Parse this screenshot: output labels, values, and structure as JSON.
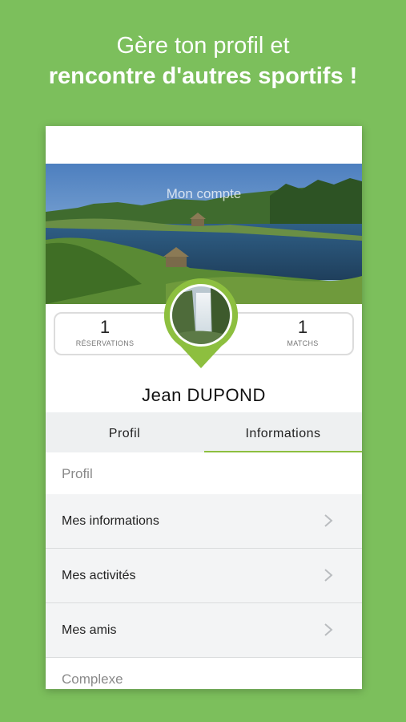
{
  "headline": {
    "line1": "Gère ton profil et",
    "line2": "rencontre d'autres sportifs !"
  },
  "screen": {
    "header_title": "Mon compte",
    "stats": [
      {
        "value": "1",
        "label": "RÉSERVATIONS"
      },
      {
        "value": "1",
        "label": "MATCHS"
      }
    ],
    "user_name": "Jean  DUPOND",
    "tabs": [
      {
        "label": "Profil",
        "active": false
      },
      {
        "label": "Informations",
        "active": true
      }
    ],
    "sections": [
      {
        "title": "Profil",
        "items": [
          {
            "label": "Mes informations",
            "icon": "chevron-right-icon"
          },
          {
            "label": "Mes activités",
            "icon": "chevron-right-icon"
          },
          {
            "label": "Mes amis",
            "icon": "chevron-right-icon"
          }
        ]
      },
      {
        "title": "Complexe",
        "items": []
      }
    ]
  },
  "colors": {
    "background": "#7cbf5c",
    "accent": "#8dbf3f"
  }
}
